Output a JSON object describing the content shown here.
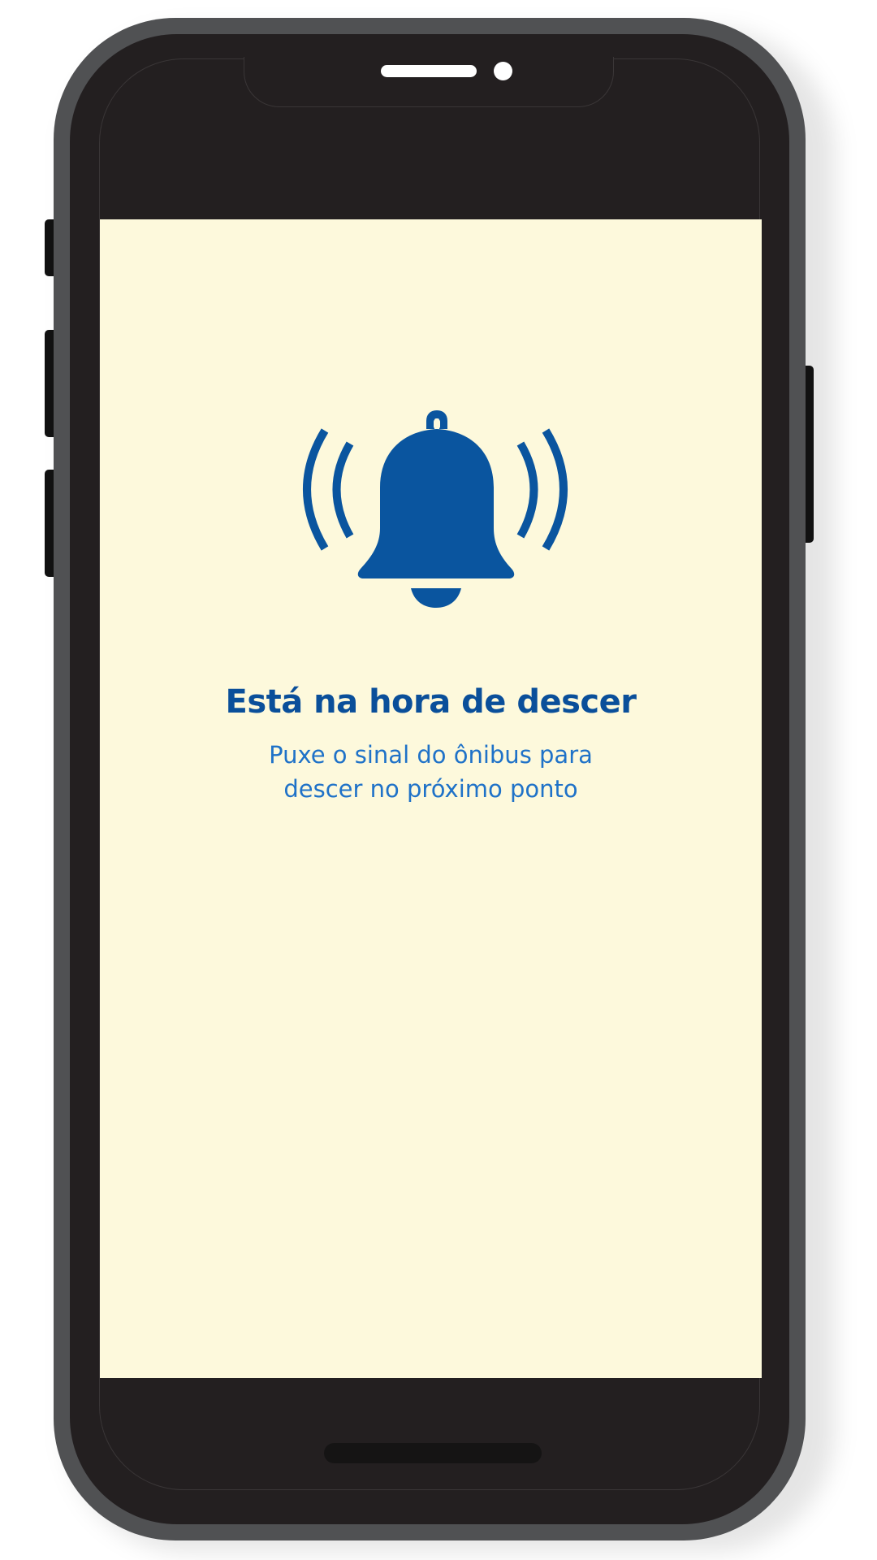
{
  "colors": {
    "screen_background": "#fdf9dc",
    "bell_blue": "#0a559f",
    "title_color": "#0a4f9a",
    "subtitle_color": "#1f72c8",
    "phone_frame": "#505153",
    "phone_bezel": "#231f20"
  },
  "alert": {
    "icon": "ringing-bell-icon",
    "title": "Está na hora de descer",
    "message_line_1": "Puxe o sinal do ônibus para",
    "message_line_2": "descer no próximo ponto"
  }
}
